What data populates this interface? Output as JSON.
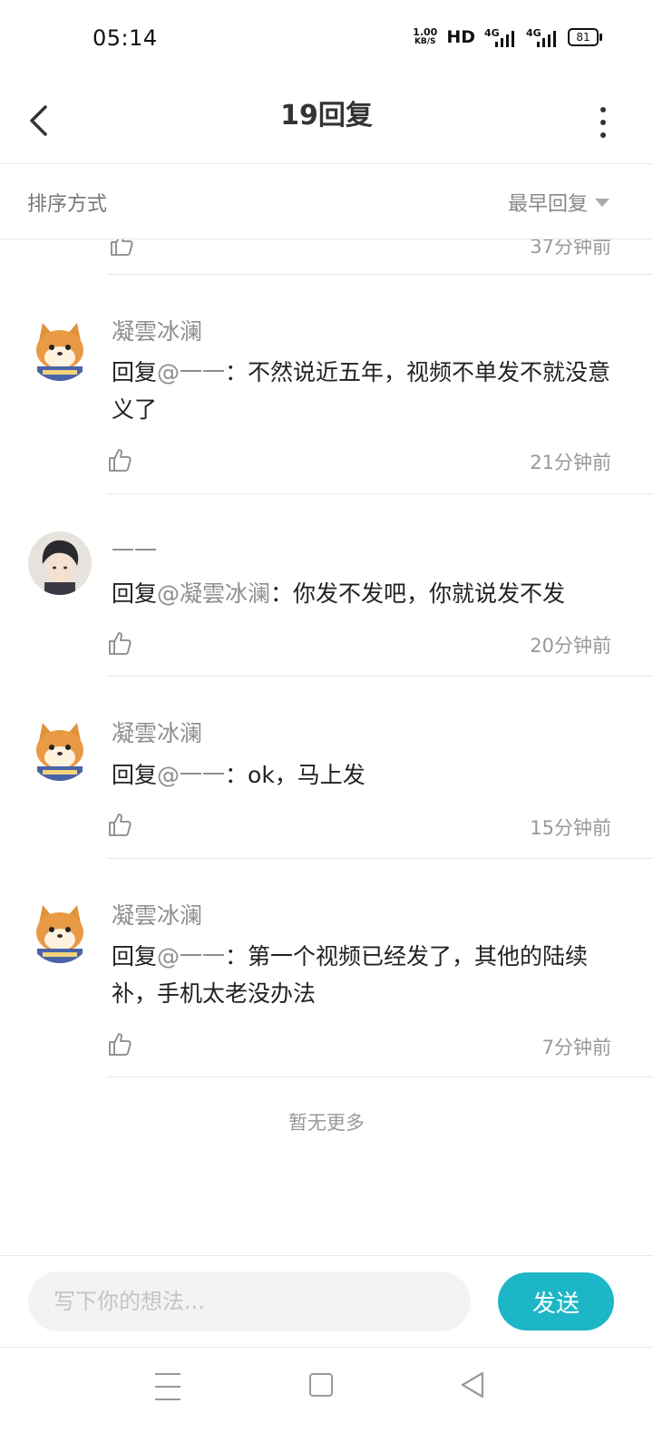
{
  "status_bar": {
    "time": "05:14",
    "net_speed_value": "1.00",
    "net_speed_unit": "KB/S",
    "hd": "HD",
    "sim1": "4G",
    "sim2": "4G",
    "battery": "81"
  },
  "header": {
    "title": "19回复"
  },
  "sort": {
    "label": "排序方式",
    "selected": "最早回复"
  },
  "partial_item": {
    "time": "37分钟前"
  },
  "comments": [
    {
      "username": "凝雲冰澜",
      "prefix": "回复",
      "mention": "@一一",
      "text": "：不然说近五年，视频不单发不就没意义了",
      "time": "21分钟前",
      "avatar": "shiba-avatar"
    },
    {
      "username": "一一",
      "prefix": "回复",
      "mention": "@凝雲冰澜",
      "text": "：你发不发吧，你就说发不发",
      "time": "20分钟前",
      "avatar": "boy-avatar"
    },
    {
      "username": "凝雲冰澜",
      "prefix": "回复",
      "mention": "@一一",
      "text": "：ok，马上发",
      "time": "15分钟前",
      "avatar": "shiba-avatar"
    },
    {
      "username": "凝雲冰澜",
      "prefix": "回复",
      "mention": "@一一",
      "text": "：第一个视频已经发了，其他的陆续补，手机太老没办法",
      "time": "7分钟前",
      "avatar": "shiba-avatar"
    }
  ],
  "footer_text": "暂无更多",
  "input": {
    "placeholder": "写下你的想法..."
  },
  "send_label": "发送",
  "colors": {
    "accent": "#1cb6c7",
    "muted_text": "#8e8e8e"
  }
}
